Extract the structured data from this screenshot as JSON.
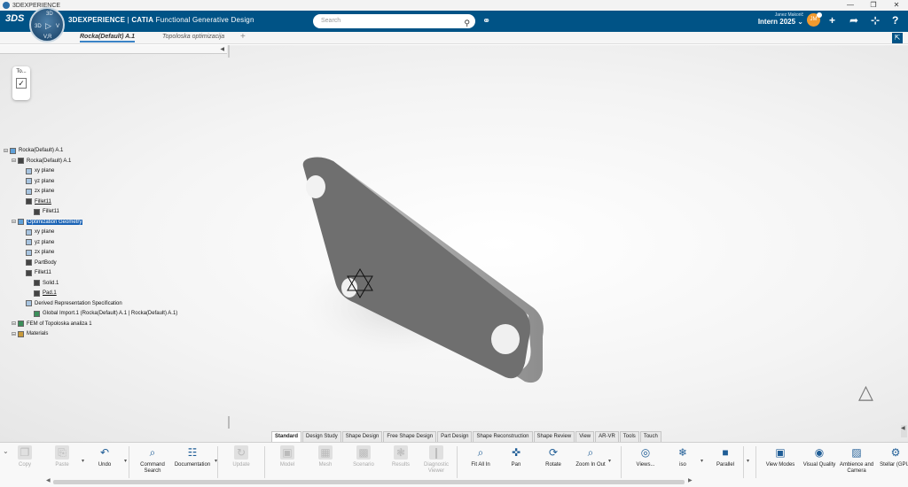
{
  "window": {
    "title": "3DEXPERIENCE"
  },
  "topbar": {
    "brand_bold": "3DEXPERIENCE",
    "brand_sep": " | ",
    "brand_app": "CATIA",
    "brand_module": " Functional Generative Design",
    "search_placeholder": "Search",
    "user_name": "Janez Makorič",
    "tenant": "Intern 2025",
    "avatar_initials": "JM"
  },
  "compass": {
    "top": "3D",
    "left": "3D",
    "right": "V",
    "bottom": "V,R"
  },
  "tabs": [
    {
      "label": "Rocka(Default) A.1",
      "active": true
    },
    {
      "label": "Topoloska optimizacija",
      "active": false
    }
  ],
  "mini_widget": {
    "label": "To..."
  },
  "tree": [
    {
      "label": "Rocka(Default) A.1",
      "level": 0,
      "icon": "product-icon",
      "style": ""
    },
    {
      "label": "Rocka(Default) A.1",
      "level": 1,
      "icon": "part-icon",
      "style": ""
    },
    {
      "label": "xy plane",
      "level": 2,
      "icon": "plane-icon",
      "style": ""
    },
    {
      "label": "yz plane",
      "level": 2,
      "icon": "plane-icon",
      "style": ""
    },
    {
      "label": "zx plane",
      "level": 2,
      "icon": "plane-icon",
      "style": ""
    },
    {
      "label": "Fillet11",
      "level": 2,
      "icon": "body-icon",
      "style": "ul"
    },
    {
      "label": "Fillet11",
      "level": 3,
      "icon": "body-icon",
      "style": ""
    },
    {
      "label": "Optimization Geometry",
      "level": 1,
      "icon": "geometry-icon",
      "style": "sel"
    },
    {
      "label": "xy plane",
      "level": 2,
      "icon": "plane-icon",
      "style": ""
    },
    {
      "label": "yz plane",
      "level": 2,
      "icon": "plane-icon",
      "style": ""
    },
    {
      "label": "zx plane",
      "level": 2,
      "icon": "plane-icon",
      "style": ""
    },
    {
      "label": "PartBody",
      "level": 2,
      "icon": "body-icon",
      "style": ""
    },
    {
      "label": "Fillet11",
      "level": 2,
      "icon": "body-icon",
      "style": ""
    },
    {
      "label": "Solid.1",
      "level": 3,
      "icon": "solid-icon",
      "style": ""
    },
    {
      "label": "Pad.1",
      "level": 3,
      "icon": "pad-icon",
      "style": "ul"
    },
    {
      "label": "Derived Representation Specification",
      "level": 2,
      "icon": "spec-icon",
      "style": ""
    },
    {
      "label": "Global Import.1 (Rocka(Default) A.1 | Rocka(Default) A.1)",
      "level": 3,
      "icon": "import-icon",
      "style": ""
    },
    {
      "label": "FEM of Topoloska analiza 1",
      "level": 1,
      "icon": "fem-icon",
      "style": ""
    },
    {
      "label": "Materials",
      "level": 1,
      "icon": "materials-icon",
      "style": ""
    }
  ],
  "bottom_tabs": [
    "Standard",
    "Design Study",
    "Shape Design",
    "Free Shape Design",
    "Part Design",
    "Shape Reconstruction",
    "Shape Review",
    "View",
    "AR-VR",
    "Tools",
    "Touch"
  ],
  "active_bottom_tab": "Standard",
  "toolbar": [
    {
      "label": "Copy",
      "enabled": false,
      "icon": "copy-icon"
    },
    {
      "label": "Paste",
      "enabled": false,
      "icon": "paste-icon"
    },
    {
      "label": "Undo",
      "enabled": true,
      "icon": "undo-icon"
    },
    {
      "label": "Command Search",
      "enabled": true,
      "icon": "command-search-icon"
    },
    {
      "label": "Documentation",
      "enabled": true,
      "icon": "documentation-icon"
    },
    {
      "label": "Update",
      "enabled": false,
      "icon": "update-icon"
    },
    {
      "label": "Model",
      "enabled": false,
      "icon": "model-icon"
    },
    {
      "label": "Mesh",
      "enabled": false,
      "icon": "mesh-icon"
    },
    {
      "label": "Scenario",
      "enabled": false,
      "icon": "scenario-icon"
    },
    {
      "label": "Results",
      "enabled": false,
      "icon": "results-icon"
    },
    {
      "label": "Diagnostic Viewer",
      "enabled": false,
      "icon": "diagnostic-viewer-icon"
    },
    {
      "label": "Fit All In",
      "enabled": true,
      "icon": "fit-all-icon"
    },
    {
      "label": "Pan",
      "enabled": true,
      "icon": "pan-icon"
    },
    {
      "label": "Rotate",
      "enabled": true,
      "icon": "rotate-icon"
    },
    {
      "label": "Zoom In Out",
      "enabled": true,
      "icon": "zoom-icon"
    },
    {
      "label": "Views...",
      "enabled": true,
      "icon": "views-icon"
    },
    {
      "label": "iso",
      "enabled": true,
      "icon": "iso-icon"
    },
    {
      "label": "Parallel",
      "enabled": true,
      "icon": "parallel-icon"
    },
    {
      "label": "View Modes",
      "enabled": true,
      "icon": "view-modes-icon"
    },
    {
      "label": "Visual Quality",
      "enabled": true,
      "icon": "visual-quality-icon"
    },
    {
      "label": "Ambience and Camera",
      "enabled": true,
      "icon": "ambience-icon"
    },
    {
      "label": "Stellar (GPU)",
      "enabled": true,
      "icon": "stellar-icon"
    }
  ]
}
